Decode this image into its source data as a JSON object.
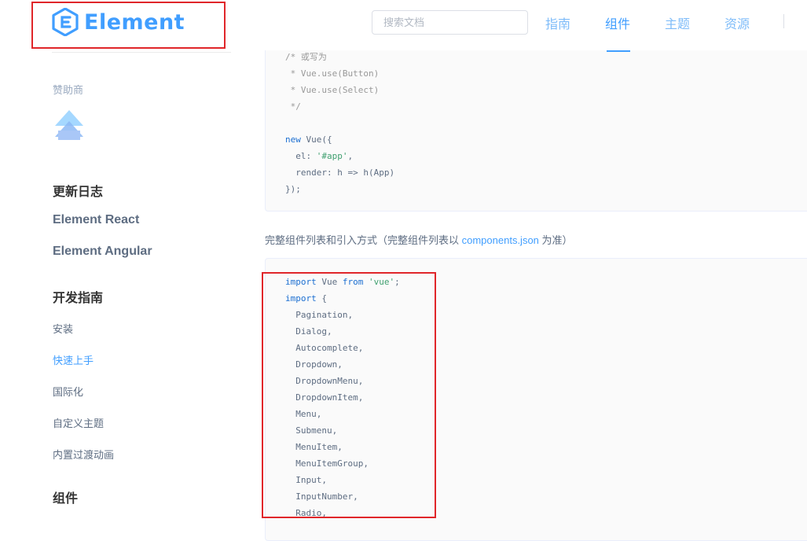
{
  "header": {
    "logo_text": "Element",
    "search_placeholder": "搜索文档",
    "nav": [
      "指南",
      "组件",
      "主题",
      "资源"
    ],
    "active_nav": "组件"
  },
  "sidebar": {
    "sponsor_label": "赞助商",
    "changelog": "更新日志",
    "element_react": "Element React",
    "element_angular": "Element Angular",
    "dev_guide": "开发指南",
    "items": [
      "安装",
      "快速上手",
      "国际化",
      "自定义主题",
      "内置过渡动画"
    ],
    "active_item": "快速上手",
    "components": "组件"
  },
  "content": {
    "code1": [
      "/* 或写为",
      " * Vue.use(Button)",
      " * Vue.use(Select)",
      " */",
      "",
      "new Vue({",
      "  el: '#app',",
      "  render: h => h(App)",
      "});"
    ],
    "para_before": "完整组件列表和引入方式（完整组件列表以 ",
    "para_link": "components.json",
    "para_after": " 为准）",
    "code2": [
      "import Vue from 'vue';",
      "import {",
      "  Pagination,",
      "  Dialog,",
      "  Autocomplete,",
      "  Dropdown,",
      "  DropdownMenu,",
      "  DropdownItem,",
      "  Menu,",
      "  Submenu,",
      "  MenuItem,",
      "  MenuItemGroup,",
      "  Input,",
      "  InputNumber,",
      "  Radio,"
    ]
  },
  "colors": {
    "accent": "#409eff",
    "highlight_box": "#e0262a"
  }
}
